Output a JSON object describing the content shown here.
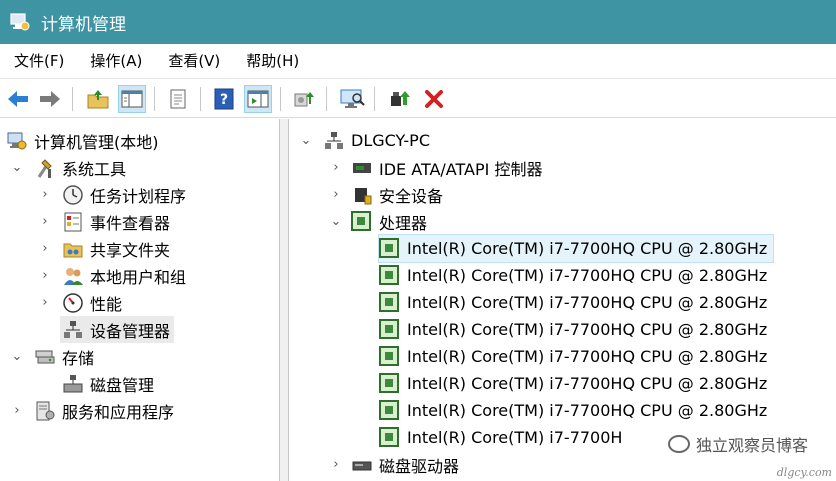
{
  "window": {
    "title": "计算机管理"
  },
  "menu": [
    {
      "label": "文件(F)"
    },
    {
      "label": "操作(A)"
    },
    {
      "label": "查看(V)"
    },
    {
      "label": "帮助(H)"
    }
  ],
  "toolbar": [
    "back-arrow-icon",
    "forward-arrow-icon",
    "up-folder-icon",
    "show-hide-tree-icon",
    "properties-icon",
    "help-icon",
    "show-action-pane-icon",
    "update-driver-icon",
    "scan-hardware-icon",
    "enable-device-icon",
    "uninstall-device-icon"
  ],
  "tree": {
    "root": {
      "label": "计算机管理(本地)"
    },
    "system_tools": {
      "label": "系统工具"
    },
    "task_scheduler": {
      "label": "任务计划程序"
    },
    "event_viewer": {
      "label": "事件查看器"
    },
    "shared_folders": {
      "label": "共享文件夹"
    },
    "local_users": {
      "label": "本地用户和组"
    },
    "performance": {
      "label": "性能"
    },
    "device_manager": {
      "label": "设备管理器"
    },
    "storage": {
      "label": "存储"
    },
    "disk_management": {
      "label": "磁盘管理"
    },
    "services_apps": {
      "label": "服务和应用程序"
    }
  },
  "devices": {
    "computer": {
      "label": "DLGCY-PC"
    },
    "ide": {
      "label": "IDE ATA/ATAPI 控制器"
    },
    "security": {
      "label": "安全设备"
    },
    "processors": {
      "label": "处理器"
    },
    "cpus": [
      "Intel(R) Core(TM) i7-7700HQ CPU @ 2.80GHz",
      "Intel(R) Core(TM) i7-7700HQ CPU @ 2.80GHz",
      "Intel(R) Core(TM) i7-7700HQ CPU @ 2.80GHz",
      "Intel(R) Core(TM) i7-7700HQ CPU @ 2.80GHz",
      "Intel(R) Core(TM) i7-7700HQ CPU @ 2.80GHz",
      "Intel(R) Core(TM) i7-7700HQ CPU @ 2.80GHz",
      "Intel(R) Core(TM) i7-7700HQ CPU @ 2.80GHz",
      "Intel(R) Core(TM) i7-7700H"
    ],
    "disk_drives": {
      "label": "磁盘驱动器"
    }
  },
  "watermark": {
    "text": "独立观察员博客",
    "url": "dlgcy.com"
  }
}
